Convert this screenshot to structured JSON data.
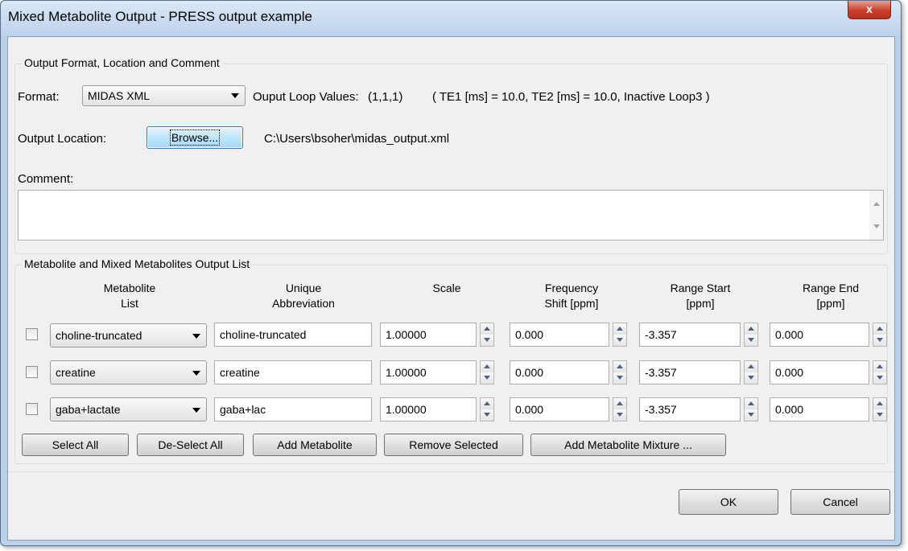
{
  "window": {
    "title": "Mixed Metabolite Output - PRESS output example",
    "close_glyph": "x"
  },
  "output_group": {
    "title": "Output Format, Location and Comment",
    "format_label": "Format:",
    "format_value": "MIDAS XML",
    "loop_label": "Ouput Loop Values:",
    "loop_values": "(1,1,1)",
    "loop_detail": "( TE1 [ms] = 10.0, TE2 [ms] = 10.0, Inactive Loop3 )",
    "location_label": "Output Location:",
    "browse_label": "Browse...",
    "location_path": "C:\\Users\\bsoher\\midas_output.xml",
    "comment_label": "Comment:",
    "comment_value": ""
  },
  "list_group": {
    "title": "Metabolite and Mixed Metabolites Output List",
    "headers": {
      "metabolite": [
        "Metabolite",
        "List"
      ],
      "abbrev": [
        "Unique",
        "Abbreviation"
      ],
      "scale": [
        "Scale"
      ],
      "freq": [
        "Frequency",
        "Shift [ppm]"
      ],
      "range_start": [
        "Range Start",
        "[ppm]"
      ],
      "range_end": [
        "Range End",
        "[ppm]"
      ]
    },
    "rows": [
      {
        "checked": false,
        "metabolite": "choline-truncated",
        "abbrev": "choline-truncated",
        "scale": "1.00000",
        "freq": "0.000",
        "range_start": "-3.357",
        "range_end": "0.000"
      },
      {
        "checked": false,
        "metabolite": "creatine",
        "abbrev": "creatine",
        "scale": "1.00000",
        "freq": "0.000",
        "range_start": "-3.357",
        "range_end": "0.000"
      },
      {
        "checked": false,
        "metabolite": "gaba+lactate",
        "abbrev": "gaba+lac",
        "scale": "1.00000",
        "freq": "0.000",
        "range_start": "-3.357",
        "range_end": "0.000"
      }
    ],
    "buttons": {
      "select_all": "Select All",
      "deselect_all": "De-Select All",
      "add_metabolite": "Add Metabolite",
      "remove_selected": "Remove Selected",
      "add_mixture": "Add Metabolite Mixture ..."
    }
  },
  "footer": {
    "ok": "OK",
    "cancel": "Cancel"
  }
}
